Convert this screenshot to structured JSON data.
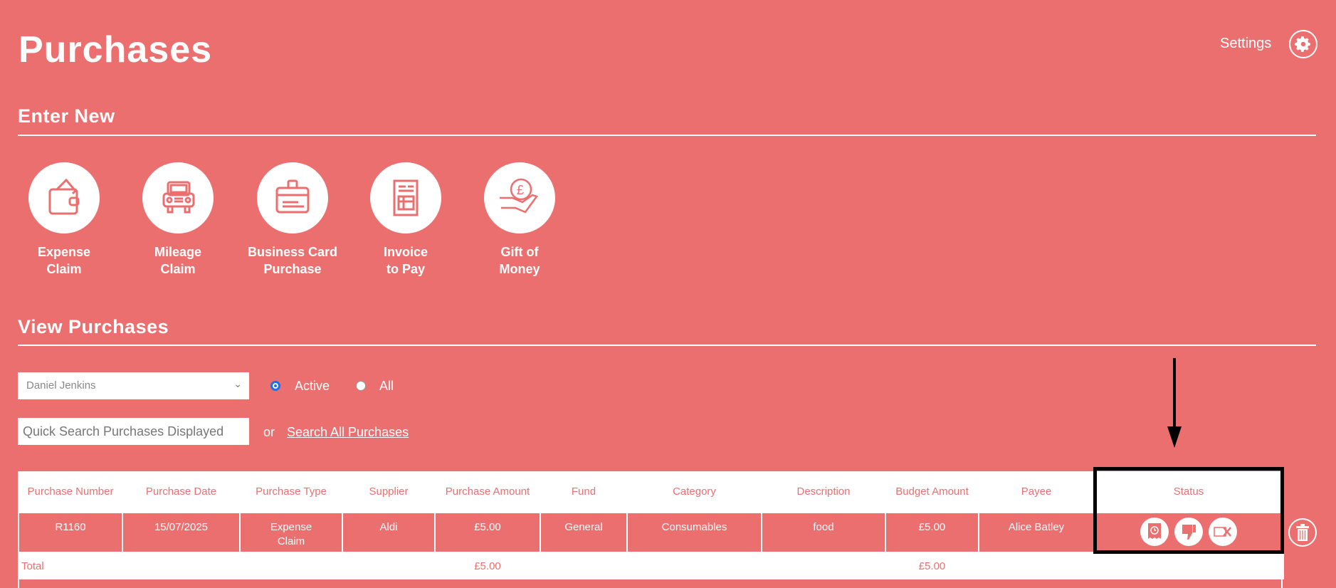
{
  "header": {
    "title": "Purchases",
    "settings_label": "Settings"
  },
  "enter_new": {
    "heading": "Enter New",
    "tiles": [
      {
        "line1": "Expense",
        "line2": "Claim",
        "icon": "wallet-icon"
      },
      {
        "line1": "Mileage",
        "line2": "Claim",
        "icon": "car-icon"
      },
      {
        "line1": "Business Card",
        "line2": "Purchase",
        "icon": "card-case-icon"
      },
      {
        "line1": "Invoice",
        "line2": "to Pay",
        "icon": "invoice-icon"
      },
      {
        "line1": "Gift of",
        "line2": "Money",
        "icon": "hand-coin-icon"
      }
    ]
  },
  "view": {
    "heading": "View Purchases",
    "selected_user": "Daniel Jenkins",
    "radio_active": "Active",
    "radio_all": "All",
    "search_placeholder": "Quick Search Purchases Displayed",
    "or": "or",
    "search_all": "Search All Purchases"
  },
  "table": {
    "headers": [
      "Purchase Number",
      "Purchase Date",
      "Purchase Type",
      "Supplier",
      "Purchase Amount",
      "Fund",
      "Category",
      "Description",
      "Budget Amount",
      "Payee",
      "Status"
    ],
    "rows": [
      {
        "number": "R1160",
        "date": "15/07/2025",
        "type": "Expense Claim",
        "supplier": "Aldi",
        "amount": "£5.00",
        "fund": "General",
        "category": "Consumables",
        "description": "food",
        "budget": "£5.00",
        "payee": "Alice Batley",
        "status_icons": [
          "receipt-clock-icon",
          "thumbs-down-icon",
          "card-cancel-icon"
        ]
      }
    ],
    "total_label": "Total",
    "total_amount": "£5.00",
    "total_budget": "£5.00"
  }
}
